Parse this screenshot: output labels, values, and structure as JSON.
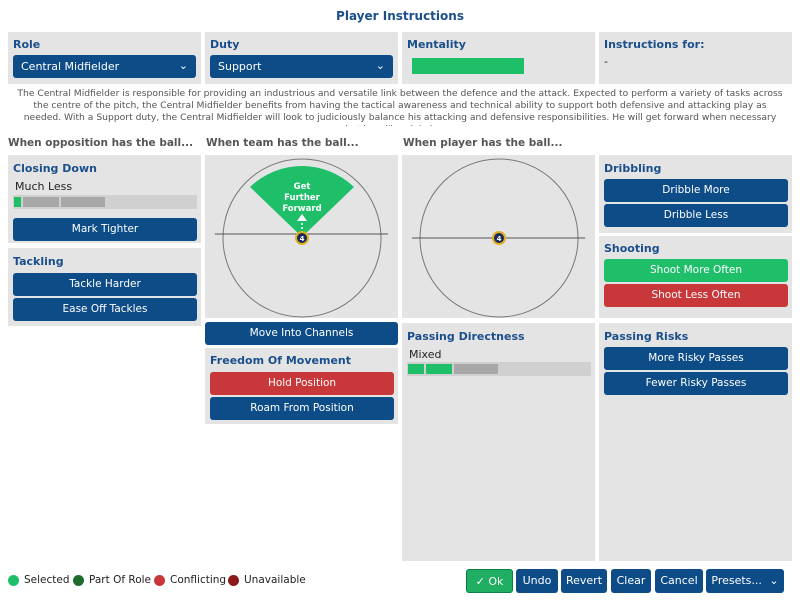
{
  "window": {
    "title": "Player Instructions"
  },
  "role": {
    "label": "Role",
    "value": "Central Midfielder"
  },
  "duty": {
    "label": "Duty",
    "value": "Support"
  },
  "mentality": {
    "label": "Mentality",
    "level": 0.6
  },
  "instructions_for": {
    "label": "Instructions for:",
    "value": "-"
  },
  "description": "The Central Midfielder is responsible for providing an industrious and versatile link between the defence and the attack. Expected to perform a variety of tasks across the centre of the pitch, the Central Midfielder benefits from having the tactical awareness and technical ability to support both defensive and attacking play as needed. With a Support duty, the Central Midfielder will look to judiciously balance his attacking and defensive responsibilities. He will get forward when necessary but he will mainly kee...",
  "sections": {
    "opposition": "When opposition has the ball...",
    "team": "When team has the ball...",
    "player": "When player has the ball..."
  },
  "closing_down": {
    "title": "Closing Down",
    "value": "Much Less",
    "button": "Mark Tighter"
  },
  "tackling": {
    "title": "Tackling",
    "buttons": [
      "Tackle Harder",
      "Ease Off Tackles"
    ]
  },
  "team_pitch": {
    "player_number": "4",
    "arrow_label": [
      "Get",
      "Further",
      "Forward"
    ]
  },
  "player_pitch": {
    "player_number": "4"
  },
  "move_into_channels": "Move Into Channels",
  "freedom": {
    "title": "Freedom Of Movement",
    "buttons": [
      "Hold Position",
      "Roam From Position"
    ]
  },
  "passing_directness": {
    "title": "Passing Directness",
    "value": "Mixed"
  },
  "dribbling": {
    "title": "Dribbling",
    "buttons": [
      "Dribble More",
      "Dribble Less"
    ]
  },
  "shooting": {
    "title": "Shooting",
    "buttons": [
      "Shoot More Often",
      "Shoot Less Often"
    ]
  },
  "passing_risks": {
    "title": "Passing Risks",
    "buttons": [
      "More Risky Passes",
      "Fewer Risky Passes"
    ]
  },
  "legend": [
    {
      "label": "Selected",
      "color": "#1fbf6a"
    },
    {
      "label": "Part Of Role",
      "color": "#1e6b2e"
    },
    {
      "label": "Conflicting",
      "color": "#c8373a"
    },
    {
      "label": "Unavailable",
      "color": "#8b1a1a"
    }
  ],
  "footer": {
    "ok": "Ok",
    "undo": "Undo",
    "revert": "Revert",
    "clear": "Clear",
    "cancel": "Cancel",
    "presets": "Presets..."
  }
}
